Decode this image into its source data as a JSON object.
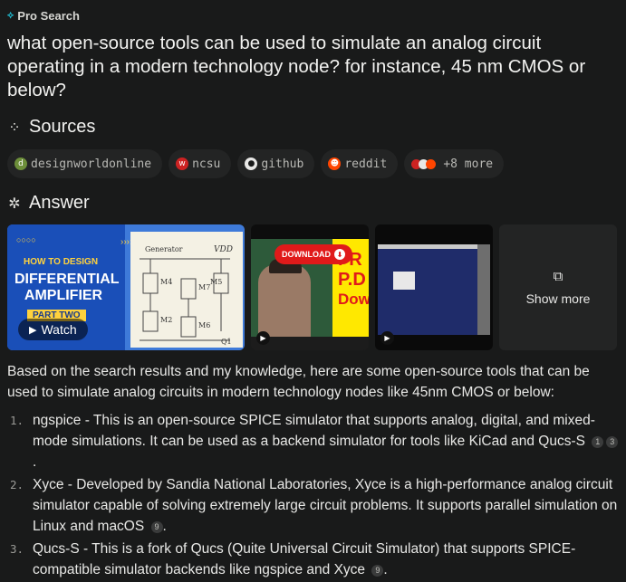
{
  "header": {
    "badge": "Pro Search"
  },
  "question": "what open-source tools can be used to simulate an analog circuit operating in a modern technology node? for instance, 45 nm CMOS or below?",
  "sources": {
    "title": "Sources",
    "chips": [
      {
        "label": "designworldonline",
        "icon": "dw-icon",
        "color": "#6d8f3a"
      },
      {
        "label": "ncsu",
        "icon": "ncsu-wolf-icon",
        "color": "#cc2222"
      },
      {
        "label": "github",
        "icon": "github-icon",
        "color": "#e8e8e6"
      },
      {
        "label": "reddit",
        "icon": "reddit-icon",
        "color": "#ff4500"
      },
      {
        "label": "+8 more",
        "icon": "more-sources-icon",
        "color": "#e8e8e6"
      }
    ]
  },
  "answer": {
    "title": "Answer",
    "media": {
      "video1": {
        "banner_small": "HOW TO DESIGN",
        "title_line1": "DIFFERENTIAL",
        "title_line2": "AMPLIFIER",
        "ribbon": "PART TWO",
        "watch_label": "Watch",
        "vdd": "VDD",
        "generator": "Generator"
      },
      "video2": {
        "download_label": "DOWNLOAD",
        "side_text_1": "FR",
        "side_text_2": "P.D",
        "side_text_3": "Downl"
      },
      "show_more": "Show more"
    },
    "intro": "Based on the search results and my knowledge, here are some open-source tools that can be used to simulate analog circuits in modern technology nodes like 45nm CMOS or below:",
    "items": [
      {
        "num": "1.",
        "text": "ngspice - This is an open-source SPICE simulator that supports analog, digital, and mixed-mode simulations. It can be used as a backend simulator for tools like KiCad and Qucs-S",
        "cites": [
          "1",
          "3"
        ]
      },
      {
        "num": "2.",
        "text": "Xyce - Developed by Sandia National Laboratories, Xyce is a high-performance analog circuit simulator capable of solving extremely large circuit problems. It supports parallel simulation on Linux and macOS",
        "cites": [
          "9"
        ]
      },
      {
        "num": "3.",
        "text": "Qucs-S - This is a fork of Qucs (Quite Universal Circuit Simulator) that supports SPICE-compatible simulator backends like ngspice and Xyce",
        "cites": [
          "9"
        ]
      }
    ]
  }
}
